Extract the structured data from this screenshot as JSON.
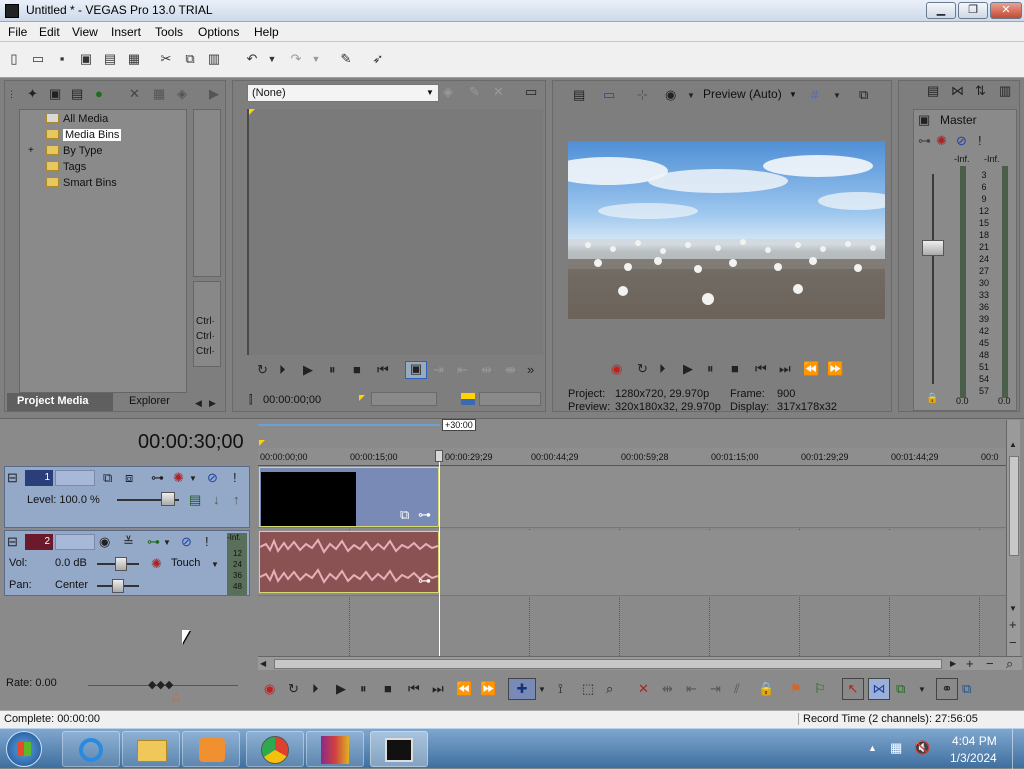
{
  "window": {
    "title": "Untitled * - VEGAS Pro 13.0 TRIAL",
    "minimize": "▁",
    "maximize": "❐",
    "close": "✕"
  },
  "menu": [
    "File",
    "Edit",
    "View",
    "Insert",
    "Tools",
    "Options",
    "Help"
  ],
  "project_media": {
    "tree": [
      "All Media",
      "Media Bins",
      "By Type",
      "Tags",
      "Smart Bins"
    ],
    "expand": "+",
    "tabs": [
      "Project Media",
      "Explorer"
    ],
    "side_labels": [
      "Ctrl·",
      "Ctrl·",
      "Ctrl·"
    ]
  },
  "trimmer": {
    "select": "(None)",
    "timecode": "00:00:00;00"
  },
  "preview": {
    "mode": "Preview (Auto)",
    "project_label": "Project:",
    "project_value": "1280x720, 29.970p",
    "preview_label": "Preview:",
    "preview_value": "320x180x32, 29.970p",
    "frame_label": "Frame:",
    "frame_value": "900",
    "display_label": "Display:",
    "display_value": "317x178x32"
  },
  "master": {
    "title": "Master",
    "inf_left": "-Inf.",
    "inf_right": "-Inf.",
    "scale": [
      "3",
      "6",
      "9",
      "12",
      "15",
      "18",
      "21",
      "24",
      "27",
      "30",
      "33",
      "36",
      "39",
      "42",
      "45",
      "48",
      "51",
      "54",
      "57"
    ],
    "bottom_left": "0.0",
    "bottom_right": "0.0"
  },
  "timeline": {
    "current_time": "00:00:30;00",
    "region_marker": "+30:00",
    "ruler": [
      "00:00:00;00",
      "00:00:15;00",
      "00:00:29;29",
      "00:00:44;29",
      "00:00:59;28",
      "00:01:15;00",
      "00:01:29;29",
      "00:01:44;29",
      "00:0"
    ],
    "video_track": {
      "number": "1",
      "level_label": "Level: 100.0 %"
    },
    "audio_track": {
      "number": "2",
      "vol_label": "Vol:",
      "vol_value": "0.0 dB",
      "pan_label": "Pan:",
      "pan_value": "Center",
      "mode": "Touch",
      "meter": [
        "-Inf.",
        "12",
        "24",
        "36",
        "48"
      ]
    },
    "rate": "Rate: 0.00"
  },
  "status": {
    "left": "Complete: 00:00:00",
    "right": "Record Time (2 channels): 27:56:05"
  },
  "clock": {
    "time": "4:04 PM",
    "date": "1/3/2024"
  }
}
